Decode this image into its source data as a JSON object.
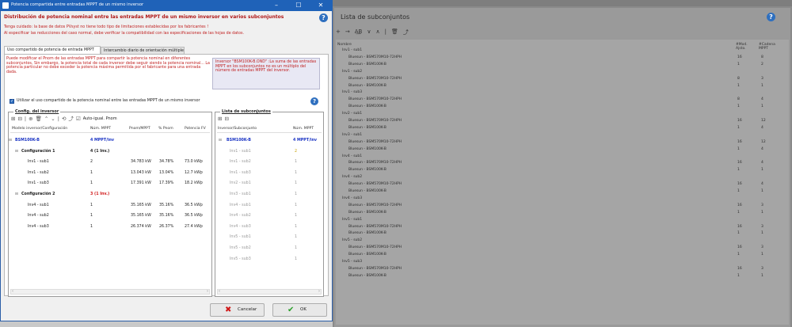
{
  "dialog": {
    "title": "Potencia compartida entre entradas MPPT de un mismo inversor",
    "heading": "Distribución de potencia nominal entre las entradas MPPT de un mismo inversor en varios subconjuntos",
    "warning1": "Tenga cuidado: la base de datos PVsyst no tiene todo tipo de limitaciones establecidas por los fabricantes !",
    "warning2": "Al especificar las reducciones del caso normal, debe verificar la compatibilidad con las especificaciones de las hojas de datos.",
    "help": "?",
    "tabs": [
      "Uso compartido de potencia de entrada MPPT",
      "Intercambio diario de orientación múltiple"
    ],
    "info_left": "Puede modificar el Pnom de las entradas MPPT para compartir la potencia nominal en diferentes subconjuntos, Sin embargo, la potencia total de cada inversor debe seguir siendo la potencia nominal... La potencia particular no debe exceder la potencia máxima permitida por el fabricante para una entrada dada.",
    "info_right": "Inversor \"BSM100K-B.OND\" :La suma de las entradas MPPT en los subconjuntos no es un múltiplo del número de entradas MPPT del inversor.",
    "checkbox_label": "Utilizar el uso compartido de la potencia nominal entre las entradas MPPT de un mismo inversor",
    "checkbox_mark": "✓",
    "config_group": {
      "title": "Config. del inversor",
      "toolbar": [
        "⊞",
        "⊟",
        "|",
        "⊕",
        "🗑",
        "⌃",
        "⌄",
        "|",
        "⟲",
        "⤴",
        "☑"
      ],
      "auto_label": "Auto-igual. Pnom",
      "columns": [
        "Modelo inversor/Configuración",
        "Núm. MPPT",
        "Pnom/MPPT",
        "% Pnom",
        "Potencia FV"
      ],
      "rows": [
        {
          "name": "BSM100K-B",
          "mppt": "4 MPPT/inv",
          "pnom": "",
          "pct": "",
          "pfv": "",
          "style": "inverter"
        },
        {
          "name": "Configuración 1",
          "mppt": "4 (1 Inv.)",
          "pnom": "",
          "pct": "",
          "pfv": "",
          "style": "config"
        },
        {
          "name": "Inv1 - sub1",
          "mppt": "2",
          "pnom": "34.783 kW",
          "pct": "34.78%",
          "pfv": "73.0 kWp",
          "style": "sub"
        },
        {
          "name": "Inv1 - sub2",
          "mppt": "1",
          "pnom": "13.043 kW",
          "pct": "13.04%",
          "pfv": "12.7 kWp",
          "style": "sub"
        },
        {
          "name": "Inv1 - sub3",
          "mppt": "1",
          "pnom": "17.391 kW",
          "pct": "17.39%",
          "pfv": "18.2 kWp",
          "style": "sub"
        },
        {
          "name": "Configuración 2",
          "mppt": "3 (1 Inv.)",
          "pnom": "",
          "pct": "",
          "pfv": "",
          "style": "config-red"
        },
        {
          "name": "Inv4 - sub1",
          "mppt": "1",
          "pnom": "35.165 kW",
          "pct": "35.16%",
          "pfv": "36.5 kWp",
          "style": "sub"
        },
        {
          "name": "Inv4 - sub2",
          "mppt": "1",
          "pnom": "35.165 kW",
          "pct": "35.16%",
          "pfv": "36.5 kWp",
          "style": "sub"
        },
        {
          "name": "Inv4 - sub3",
          "mppt": "1",
          "pnom": "26.374 kW",
          "pct": "26.37%",
          "pfv": "27.4 kWp",
          "style": "sub"
        }
      ]
    },
    "subset_group": {
      "title": "Lista de subconjuntos",
      "toolbar": [
        "⊞",
        "⊟"
      ],
      "columns": [
        "Inversor/Subconjunto",
        "Núm. MPPT"
      ],
      "rows": [
        {
          "name": "BSM100K-B",
          "mppt": "4 MPPT/inv",
          "style": "inverter"
        },
        {
          "name": "Inv1 - sub1",
          "mppt": "2",
          "style": "sub-active"
        },
        {
          "name": "Inv1 - sub2",
          "mppt": "1",
          "style": "sub"
        },
        {
          "name": "Inv1 - sub3",
          "mppt": "1",
          "style": "sub"
        },
        {
          "name": "Inv2 - sub1",
          "mppt": "1",
          "style": "sub"
        },
        {
          "name": "Inv3 - sub1",
          "mppt": "1",
          "style": "sub"
        },
        {
          "name": "Inv4 - sub1",
          "mppt": "1",
          "style": "sub"
        },
        {
          "name": "Inv4 - sub2",
          "mppt": "1",
          "style": "sub"
        },
        {
          "name": "Inv4 - sub3",
          "mppt": "1",
          "style": "sub"
        },
        {
          "name": "Inv5 - sub1",
          "mppt": "1",
          "style": "sub"
        },
        {
          "name": "Inv5 - sub2",
          "mppt": "1",
          "style": "sub"
        },
        {
          "name": "Inv5 - sub3",
          "mppt": "1",
          "style": "sub"
        }
      ]
    },
    "buttons": {
      "cancel": "Cancelar",
      "ok": "OK",
      "cancel_icon": "✖",
      "ok_icon": "✔"
    }
  },
  "background": {
    "title": "Lista de subconjuntos",
    "help": "?",
    "toolbar": [
      "+",
      "→",
      "A͟B",
      "∨",
      "∧",
      "|",
      "🗑",
      "⤴"
    ],
    "col_name": "Nombre",
    "col_mod": "#Mod. Ajsto.",
    "col_cad": "#Cadena MPPT",
    "rows": [
      {
        "name": "Inv1 - sub1",
        "a": "",
        "b": "",
        "level": 0
      },
      {
        "name": "Bluesun - BSM570M10-72HPH",
        "a": "16",
        "b": "8",
        "level": 1
      },
      {
        "name": "Bluesun - BSM100K-B",
        "a": "1",
        "b": "2",
        "level": 1
      },
      {
        "name": "Inv1 - sub2",
        "a": "",
        "b": "",
        "level": 0
      },
      {
        "name": "Bluesun - BSM570M10-72HPH",
        "a": "8",
        "b": "3",
        "level": 1
      },
      {
        "name": "Bluesun - BSM100K-B",
        "a": "1",
        "b": "1",
        "level": 1
      },
      {
        "name": "Inv1 - sub3",
        "a": "",
        "b": "",
        "level": 0
      },
      {
        "name": "Bluesun - BSM570M10-72HPH",
        "a": "8",
        "b": "4",
        "level": 1
      },
      {
        "name": "Bluesun - BSM100K-B",
        "a": "1",
        "b": "1",
        "level": 1
      },
      {
        "name": "Inv2 - sub1",
        "a": "",
        "b": "",
        "level": 0
      },
      {
        "name": "Bluesun - BSM570M10-72HPH",
        "a": "16",
        "b": "12",
        "level": 1
      },
      {
        "name": "Bluesun - BSM100K-B",
        "a": "1",
        "b": "4",
        "level": 1
      },
      {
        "name": "Inv3 - sub1",
        "a": "",
        "b": "",
        "level": 0
      },
      {
        "name": "Bluesun - BSM570M10-72HPH",
        "a": "16",
        "b": "12",
        "level": 1
      },
      {
        "name": "Bluesun - BSM100K-B",
        "a": "1",
        "b": "4",
        "level": 1
      },
      {
        "name": "Inv4 - sub1",
        "a": "",
        "b": "",
        "level": 0
      },
      {
        "name": "Bluesun - BSM570M10-72HPH",
        "a": "16",
        "b": "4",
        "level": 1
      },
      {
        "name": "Bluesun - BSM100K-B",
        "a": "1",
        "b": "1",
        "level": 1
      },
      {
        "name": "Inv4 - sub2",
        "a": "",
        "b": "",
        "level": 0
      },
      {
        "name": "Bluesun - BSM570M10-72HPH",
        "a": "16",
        "b": "4",
        "level": 1
      },
      {
        "name": "Bluesun - BSM100K-B",
        "a": "1",
        "b": "1",
        "level": 1
      },
      {
        "name": "Inv4 - sub3",
        "a": "",
        "b": "",
        "level": 0
      },
      {
        "name": "Bluesun - BSM570M10-72HPH",
        "a": "16",
        "b": "3",
        "level": 1
      },
      {
        "name": "Bluesun - BSM100K-B",
        "a": "1",
        "b": "1",
        "level": 1
      },
      {
        "name": "Inv5 - sub1",
        "a": "",
        "b": "",
        "level": 0
      },
      {
        "name": "Bluesun - BSM570M10-72HPH",
        "a": "16",
        "b": "3",
        "level": 1
      },
      {
        "name": "Bluesun - BSM100K-B",
        "a": "1",
        "b": "1",
        "level": 1
      },
      {
        "name": "Inv5 - sub2",
        "a": "",
        "b": "",
        "level": 0
      },
      {
        "name": "Bluesun - BSM570M10-72HPH",
        "a": "16",
        "b": "3",
        "level": 1
      },
      {
        "name": "Bluesun - BSM100K-B",
        "a": "1",
        "b": "1",
        "level": 1
      },
      {
        "name": "Inv5 - sub3",
        "a": "",
        "b": "",
        "level": 0
      },
      {
        "name": "Bluesun - BSM570M10-72HPH",
        "a": "16",
        "b": "3",
        "level": 1
      },
      {
        "name": "Bluesun - BSM100K-B",
        "a": "1",
        "b": "1",
        "level": 1
      }
    ]
  },
  "colors": {
    "titlebar": "#1f62b8",
    "accent_blue": "#1a34c4",
    "warning_red": "#c02020",
    "ok_green": "#2aa02a",
    "cancel_red": "#d01818"
  }
}
